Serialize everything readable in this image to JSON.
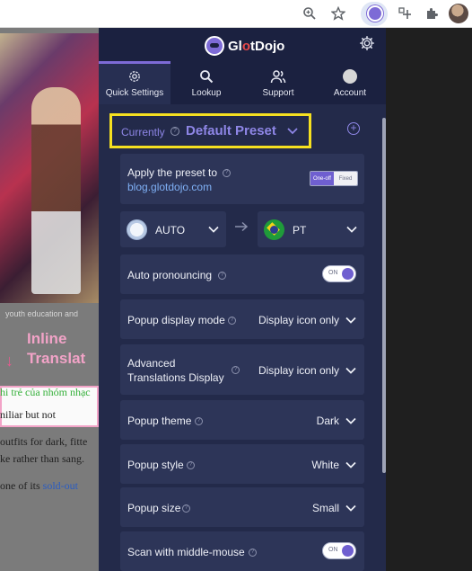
{
  "page": {
    "caption": "youth education and",
    "inline_label_1": "Inline",
    "inline_label_2": "Translat",
    "translated_green": "hi trẻ của nhóm nhạc",
    "translated_dark": "niliar but not",
    "body_line_1": "outfits for dark, fitte",
    "body_line_2": "ke rather than sang.",
    "body_line_3_prefix": "one of its ",
    "body_line_3_link": "sold-out"
  },
  "popup": {
    "brand_prefix": "Gl",
    "brand_dot": "o",
    "brand_suffix": "tDojo",
    "nav": [
      {
        "label": "Quick Settings",
        "icon": "gear-icon"
      },
      {
        "label": "Lookup",
        "icon": "search-icon"
      },
      {
        "label": "Support",
        "icon": "people-icon"
      },
      {
        "label": "Account",
        "icon": "avatar-icon"
      }
    ],
    "preset": {
      "currently_label": "Currently",
      "name": "Default Preset"
    },
    "apply_preset": {
      "label": "Apply the preset to",
      "site": "blog.glotdojo.com",
      "option_on": "One-off",
      "option_off": "Fixed"
    },
    "languages": {
      "source": "AUTO",
      "target": "PT"
    },
    "settings": {
      "auto_pronouncing": {
        "label": "Auto pronouncing",
        "toggle": "ON",
        "enabled": true
      },
      "popup_display_mode": {
        "label": "Popup display mode",
        "value": "Display icon only"
      },
      "advanced_translations": {
        "label_1": "Advanced",
        "label_2": "Translations Display",
        "value": "Display icon only"
      },
      "popup_theme": {
        "label": "Popup theme",
        "value": "Dark"
      },
      "popup_style": {
        "label": "Popup style",
        "value": "White"
      },
      "popup_size": {
        "label": "Popup size",
        "value": "Small"
      },
      "scan_middle_mouse": {
        "label": "Scan with middle-mouse",
        "toggle": "ON",
        "enabled": true
      }
    }
  },
  "colors": {
    "accent": "#7d6bd6",
    "highlight_border": "#f5e020",
    "popup_bg": "#232a4a",
    "card_bg": "#2d3558",
    "link": "#7fb0f5"
  }
}
